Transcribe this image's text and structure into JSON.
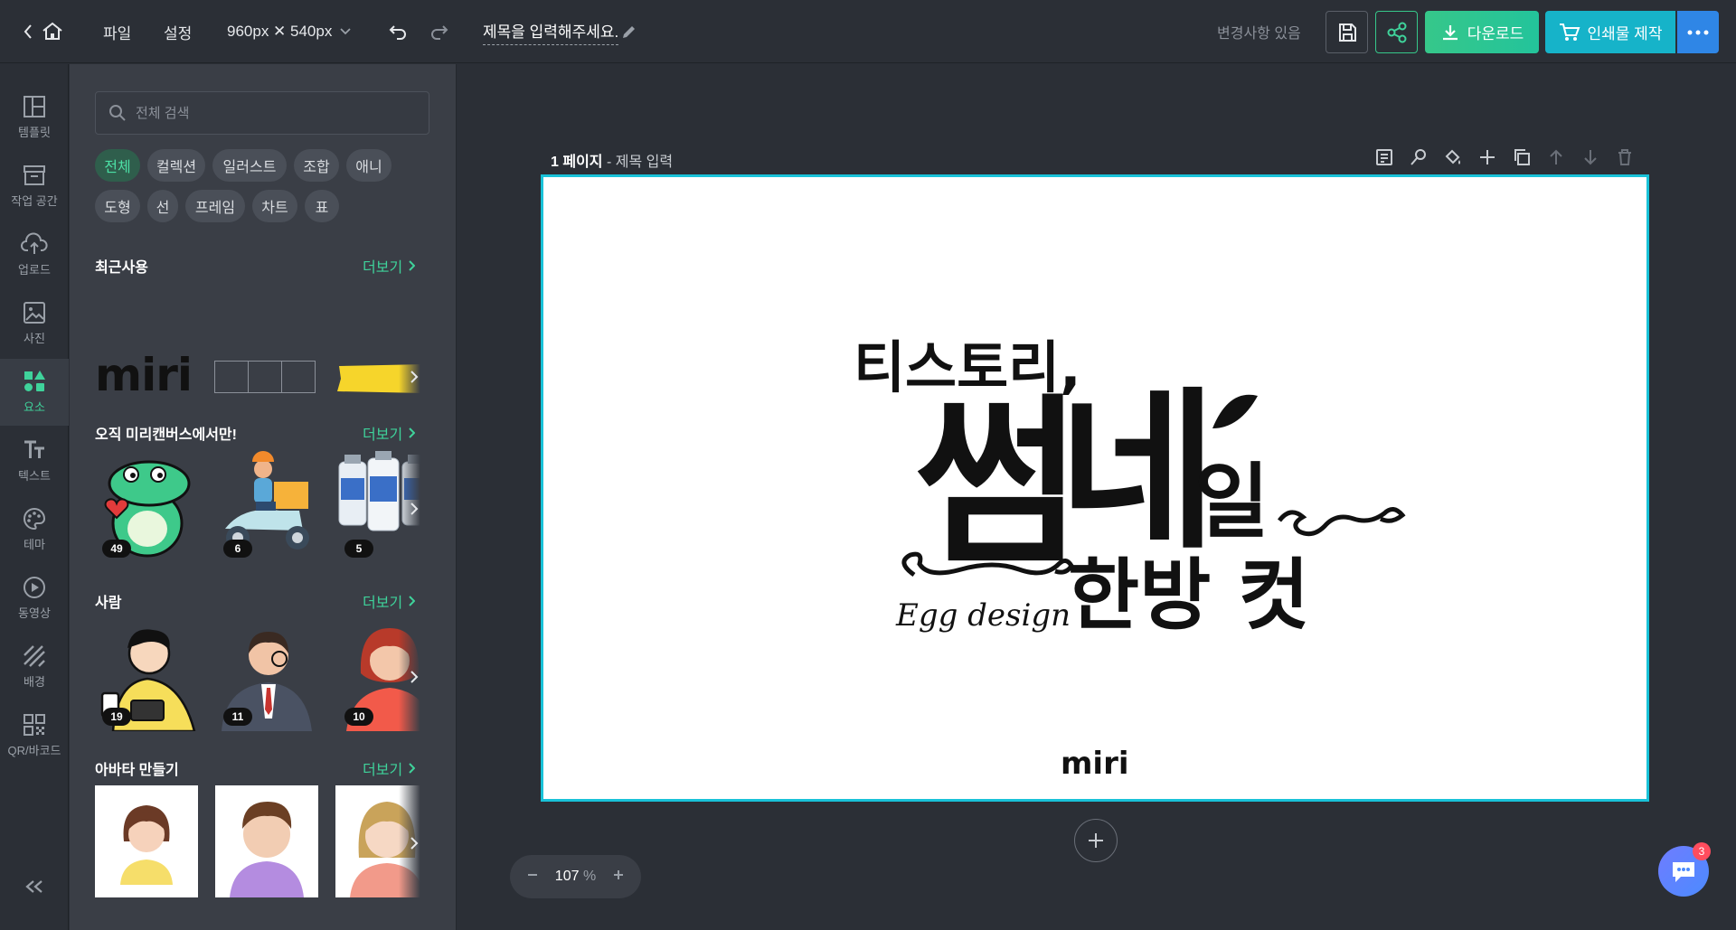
{
  "topbar": {
    "menu_file": "파일",
    "menu_settings": "설정",
    "canvas_size": "960px ✕ 540px",
    "doc_title": "제목을 입력해주세요.",
    "save_status": "변경사항 있음",
    "download_label": "다운로드",
    "print_label": "인쇄물 제작"
  },
  "rail": {
    "items": [
      {
        "label": "템플릿",
        "icon": "template-icon"
      },
      {
        "label": "작업 공간",
        "icon": "workspace-icon"
      },
      {
        "label": "업로드",
        "icon": "upload-icon"
      },
      {
        "label": "사진",
        "icon": "photo-icon"
      },
      {
        "label": "요소",
        "icon": "elements-icon"
      },
      {
        "label": "텍스트",
        "icon": "text-icon"
      },
      {
        "label": "테마",
        "icon": "theme-icon"
      },
      {
        "label": "동영상",
        "icon": "video-icon"
      },
      {
        "label": "배경",
        "icon": "background-icon"
      },
      {
        "label": "QR/바코드",
        "icon": "qr-icon"
      }
    ],
    "active": "요소"
  },
  "panel": {
    "search_placeholder": "전체 검색",
    "chips": [
      "전체",
      "컬렉션",
      "일러스트",
      "조합",
      "애니",
      "도형",
      "선",
      "프레임",
      "차트",
      "표"
    ],
    "active_chip": "전체",
    "more_label": "더보기",
    "sections": {
      "recent": {
        "title": "최근사용"
      },
      "only_miri": {
        "title": "오직 미리캔버스에서만!",
        "counts": [
          "49",
          "6",
          "5"
        ]
      },
      "people": {
        "title": "사람",
        "counts": [
          "19",
          "11",
          "10"
        ]
      },
      "avatar": {
        "title": "아바타 만들기"
      }
    },
    "recent_logo_text": "miri"
  },
  "canvas": {
    "page_number": "1 페이지",
    "page_title_separator": " - ",
    "page_title": "제목 입력",
    "design": {
      "line1": "티스토리,",
      "big1": "썸",
      "big2": "네",
      "small1": "일",
      "line3": "한방 컷",
      "signature": "Egg design",
      "footer_logo": "miri"
    },
    "zoom_value": "107",
    "zoom_unit": "%"
  },
  "chat": {
    "unread": "3"
  },
  "colors": {
    "accent_green": "#3fd39b",
    "accent_teal": "#16b3c9",
    "accent_blue": "#2f86e6",
    "page_outline": "#19c2d8"
  }
}
